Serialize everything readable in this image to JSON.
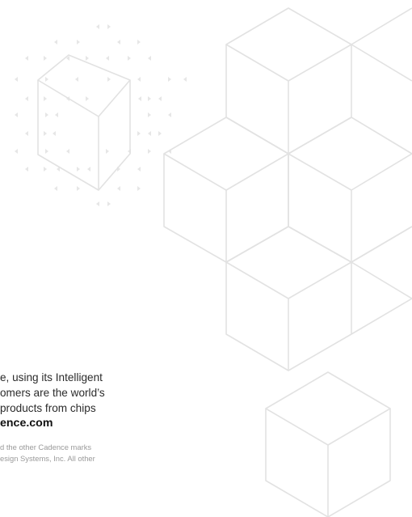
{
  "colors": {
    "cube_stroke": "#e2e2e2",
    "dot_arrow": "#e6e6e6",
    "body_text": "#2b2b2b",
    "fine_print": "#9a9a9a"
  },
  "icons": [
    "cube-outline-icon",
    "small-arrow-icon"
  ],
  "body_lines": [
    "e, using its Intelligent",
    "omers are the world’s",
    " products from chips",
    "ence.com"
  ],
  "fine_print_lines": [
    "d the other Cadence marks",
    "esign Systems, Inc. All other"
  ]
}
